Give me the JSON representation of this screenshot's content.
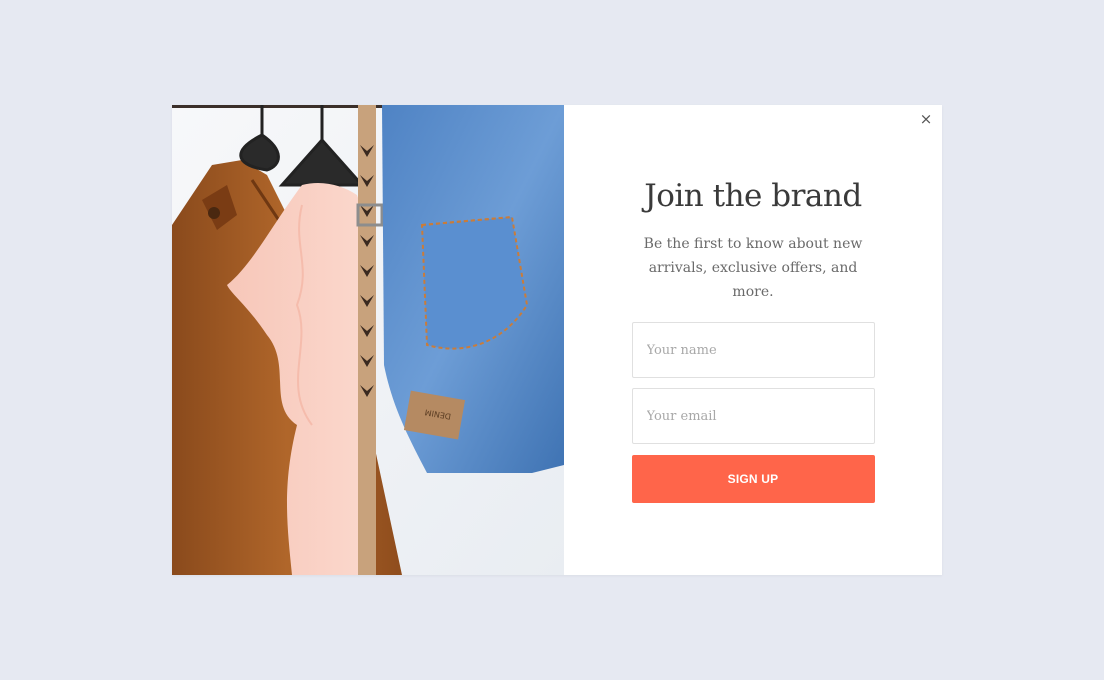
{
  "popup": {
    "title": "Join the brand",
    "subtitle": "Be the first to know about new arrivals, exclusive offers, and more.",
    "close_label": "×",
    "form": {
      "name_placeholder": "Your name",
      "email_placeholder": "Your email",
      "submit_label": "SIGN UP"
    },
    "image": {
      "tag_text": "DENIM"
    },
    "colors": {
      "page_background": "#e6e9f2",
      "accent": "#ff654a",
      "title": "#3a3a3a",
      "subtitle": "#6a6a6a"
    }
  }
}
